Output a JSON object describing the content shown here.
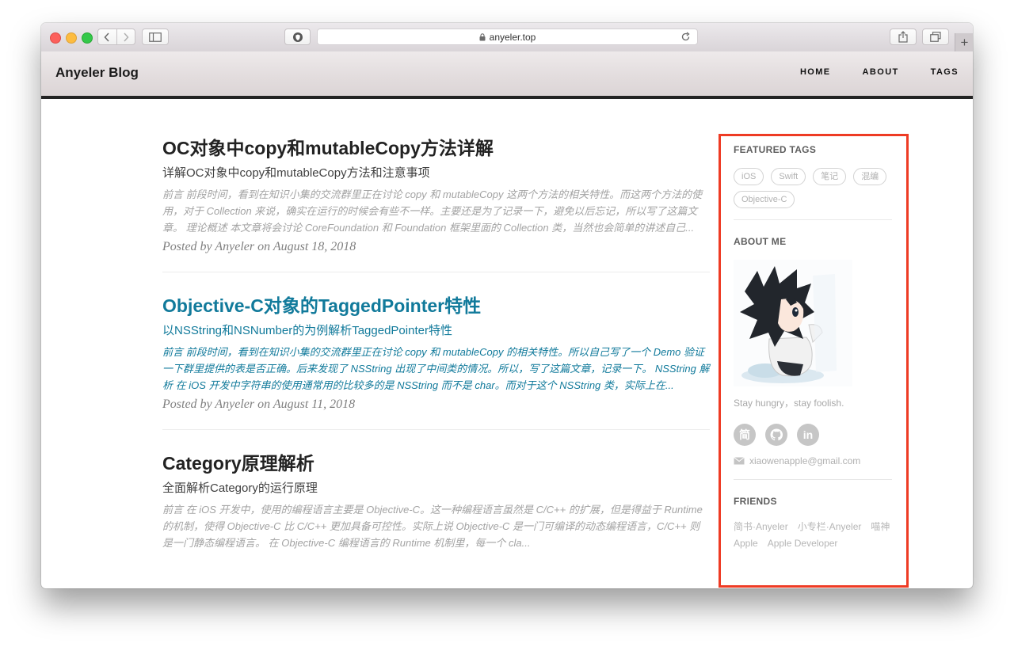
{
  "browser": {
    "url": "anyeler.top"
  },
  "site": {
    "brand": "Anyeler Blog",
    "nav": [
      "HOME",
      "ABOUT",
      "TAGS"
    ]
  },
  "posts": [
    {
      "title": "OC对象中copy和mutableCopy方法详解",
      "subtitle": "详解OC对象中copy和mutableCopy方法和注意事项",
      "excerpt": "前言 前段时间，看到在知识小集的交流群里正在讨论 copy 和 mutableCopy 这两个方法的相关特性。而这两个方法的使用，对于 Collection 来说，确实在运行的时候会有些不一样。主要还是为了记录一下，避免以后忘记，所以写了这篇文章。 理论概述 本文章将会讨论 CoreFoundation 和 Foundation 框架里面的 Collection 类，当然也会简单的讲述自己...",
      "meta": "Posted by Anyeler on August 18, 2018"
    },
    {
      "title": "Objective-C对象的TaggedPointer特性",
      "subtitle": "以NSString和NSNumber的为例解析TaggedPointer特性",
      "excerpt": "前言 前段时间，看到在知识小集的交流群里正在讨论 copy 和 mutableCopy 的相关特性。所以自己写了一个 Demo 验证一下群里提供的表是否正确。后来发现了 NSString 出现了中间类的情况。所以，写了这篇文章，记录一下。 NSString 解析 在 iOS 开发中字符串的使用通常用的比较多的是 NSString 而不是 char。而对于这个 NSString 类，实际上在...",
      "meta": "Posted by Anyeler on August 11, 2018"
    },
    {
      "title": "Category原理解析",
      "subtitle": "全面解析Category的运行原理",
      "excerpt": "前言 在 iOS 开发中，使用的编程语言主要是 Objective-C。这一种编程语言虽然是 C/C++ 的扩展，但是得益于 Runtime 的机制，使得 Objective-C 比 C/C++ 更加具备可控性。实际上说 Objective-C 是一门可编译的动态编程语言，C/C++ 则是一门静态编程语言。 在 Objective-C 编程语言的 Runtime 机制里，每一个 cla...",
      "meta": ""
    }
  ],
  "sidebar": {
    "featured_title": "FEATURED TAGS",
    "tags": [
      "iOS",
      "Swift",
      "笔记",
      "混编",
      "Objective-C"
    ],
    "about_title": "ABOUT ME",
    "motto": "Stay hungry，stay foolish.",
    "socials": [
      {
        "icon": "jianshu-icon",
        "glyph": "简"
      },
      {
        "icon": "github-icon",
        "glyph": ""
      },
      {
        "icon": "linkedin-icon",
        "glyph": "in"
      }
    ],
    "email": "xiaowenapple@gmail.com",
    "friends_title": "FRIENDS",
    "friends": [
      "简书·Anyeler",
      "小专栏·Anyeler",
      "喵神",
      "Apple",
      "Apple Developer"
    ]
  },
  "colors": {
    "accent": "#117a9b",
    "highlight_border": "#ee3b24",
    "nav_underline": "#232323"
  }
}
